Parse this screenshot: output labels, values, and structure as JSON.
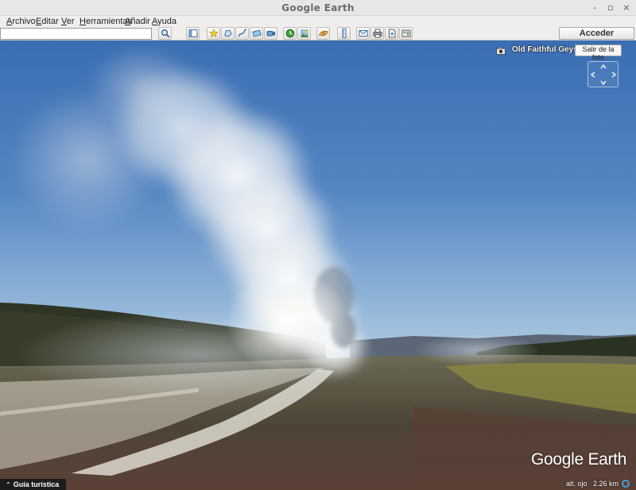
{
  "window": {
    "title": "Google Earth",
    "controls": {
      "minimize": "-",
      "maximize": "▫",
      "close": "×"
    }
  },
  "menu": [
    {
      "mnemonic": "A",
      "rest": "rchivo"
    },
    {
      "mnemonic": "E",
      "rest": "ditar"
    },
    {
      "mnemonic": "V",
      "rest": "er"
    },
    {
      "mnemonic": "H",
      "rest": "erramientas"
    },
    {
      "mnemonic": "A",
      "rest": "ñadir"
    },
    {
      "mnemonic": "A",
      "rest": "yuda"
    }
  ],
  "toolbar": {
    "search_value": "",
    "login_label": "Acceder",
    "tools": [
      "search-icon",
      "sidebar-toggle-icon",
      "placemark-icon",
      "polygon-icon",
      "path-icon",
      "image-overlay-icon",
      "record-tour-icon",
      "historical-imagery-icon",
      "sunlight-icon",
      "planets-icon",
      "ruler-icon",
      "email-icon",
      "print-icon",
      "save-image-icon",
      "map-view-icon"
    ]
  },
  "photo": {
    "title": "Old Faithful Geyser",
    "exit_label": "Salir de la foto"
  },
  "brand": "Google Earth",
  "tour_guide_label": "Guía turística",
  "status": {
    "altitude_label": "alt. ojo",
    "altitude_value": "2.26 km"
  },
  "colors": {
    "sky_top": "#3f72b5",
    "sky_horizon": "#a9c6df",
    "accent_blue": "#4b9bd6"
  }
}
